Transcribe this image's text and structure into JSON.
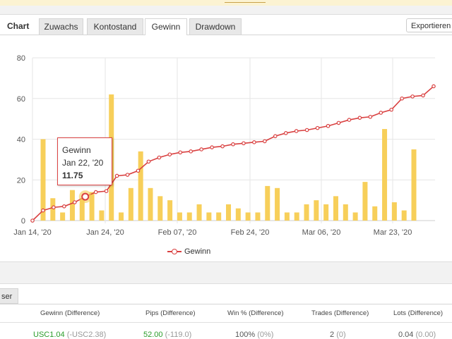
{
  "window": {
    "top_link": ""
  },
  "tabs": {
    "title": "Chart",
    "items": [
      {
        "label": "Zuwachs"
      },
      {
        "label": "Kontostand"
      },
      {
        "label": "Gewinn"
      },
      {
        "label": "Drawdown"
      }
    ],
    "active": "Gewinn",
    "export_label": "Exportieren"
  },
  "colors": {
    "bar": "#f7cf5a",
    "line": "#d94040",
    "grid": "#e6e6e6"
  },
  "chart_data": {
    "type": "bar",
    "x_tick_labels": [
      "Jan 14, '20",
      "Jan 24, '20",
      "Feb 07, '20",
      "Feb 24, '20",
      "Mar 06, '20",
      "Mar 23, '20"
    ],
    "y_ticks": [
      0,
      20,
      40,
      60,
      80
    ],
    "ylim": [
      0,
      80
    ],
    "grid": true,
    "legend_position": "bottom",
    "bars": [
      40,
      11,
      4,
      15,
      11,
      14,
      5,
      62,
      4,
      16,
      34,
      16,
      12,
      10,
      4,
      4,
      8,
      4,
      4,
      8,
      6,
      4,
      4,
      17,
      16,
      4,
      4,
      8,
      10,
      8,
      12,
      8,
      4,
      19,
      7,
      45,
      9,
      5,
      35
    ],
    "series": [
      {
        "name": "Gewinn",
        "values": [
          0,
          5,
          6.5,
          7,
          9,
          11.75,
          14,
          14.5,
          22,
          22.5,
          24.5,
          29,
          31,
          32.5,
          33.5,
          34,
          35,
          36,
          36.5,
          37.5,
          38,
          38.5,
          39,
          41.5,
          43,
          44,
          44.5,
          45.5,
          46.5,
          48,
          49.5,
          50.5,
          51,
          53,
          54.5,
          60,
          61,
          61.5,
          66
        ]
      }
    ],
    "tooltip": {
      "series": "Gewinn",
      "date": "Jan 22, '20",
      "value": "11.75"
    }
  },
  "legend": {
    "label": "Gewinn"
  },
  "lower": {
    "subtab": "ser",
    "headers": [
      "Gewinn (Difference)",
      "Pips (Difference)",
      "Win % (Difference)",
      "Trades (Difference)",
      "Lots (Difference)"
    ],
    "row": {
      "gewinn": "USC1.04",
      "gewinn_diff": "(-USC2.38)",
      "pips": "52.00",
      "pips_diff": "(-119.0)",
      "win": "100%",
      "win_diff": "(0%)",
      "trades": "2",
      "trades_diff": "(0)",
      "lots": "0.04",
      "lots_diff": "(0.00)"
    }
  }
}
